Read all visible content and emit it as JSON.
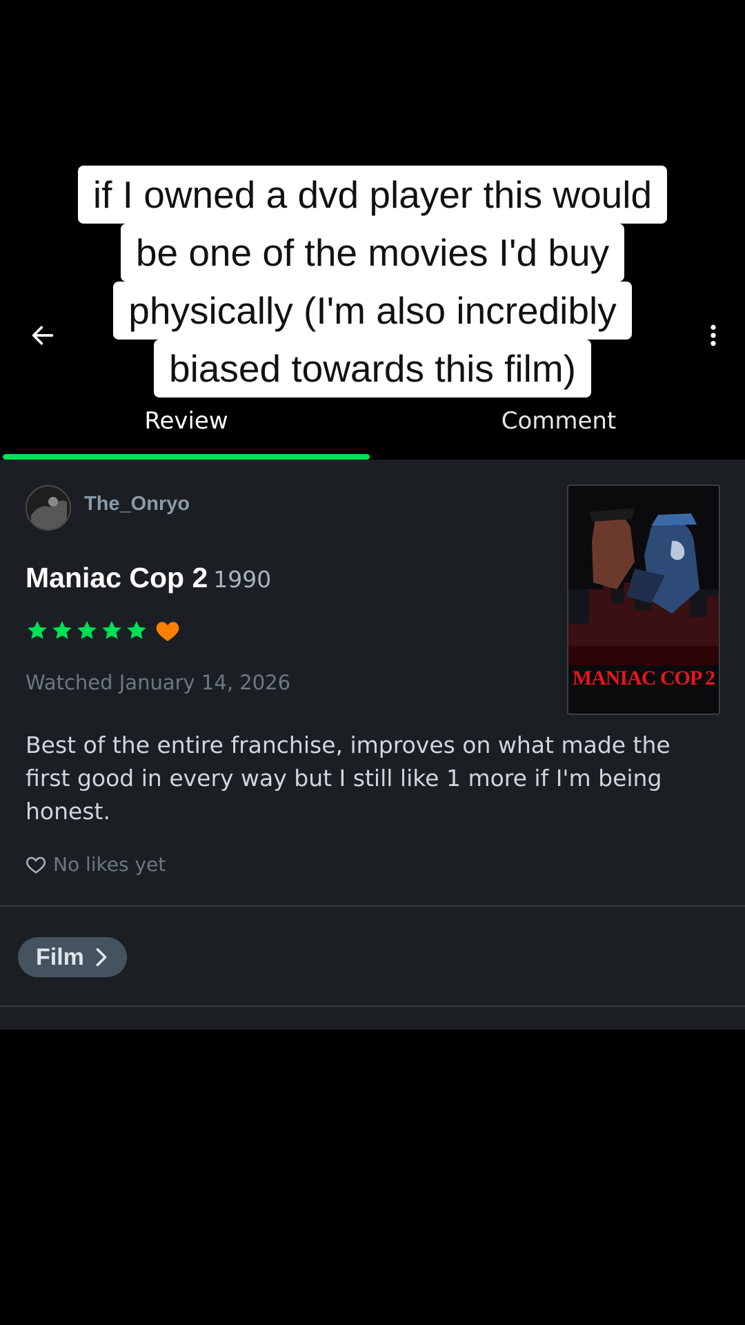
{
  "caption": {
    "lines": [
      "if I owned a dvd player this would",
      "be one of the movies I'd buy",
      "physically (I'm also incredibly",
      "biased towards this film)"
    ]
  },
  "nav": {
    "back_icon": "arrow-left-icon",
    "more_icon": "more-vertical-icon"
  },
  "tabs": [
    {
      "label": "Review",
      "active": true
    },
    {
      "label": "Comment",
      "active": false
    }
  ],
  "review": {
    "username": "The_Onryo",
    "film_title": "Maniac Cop 2",
    "film_year": "1990",
    "rating_stars": 5,
    "liked": true,
    "watched": "Watched January 14, 2026",
    "poster_title": "MANIAC COP 2",
    "text": "Best of the entire franchise, improves on what made the first good in every way but I still like 1 more if I'm being honest.",
    "likes_text": "No likes yet"
  },
  "film_chip": {
    "label": "Film"
  },
  "colors": {
    "accent_green": "#00e054",
    "heart_orange": "#ff8000",
    "panel_bg": "#1b1f24"
  }
}
